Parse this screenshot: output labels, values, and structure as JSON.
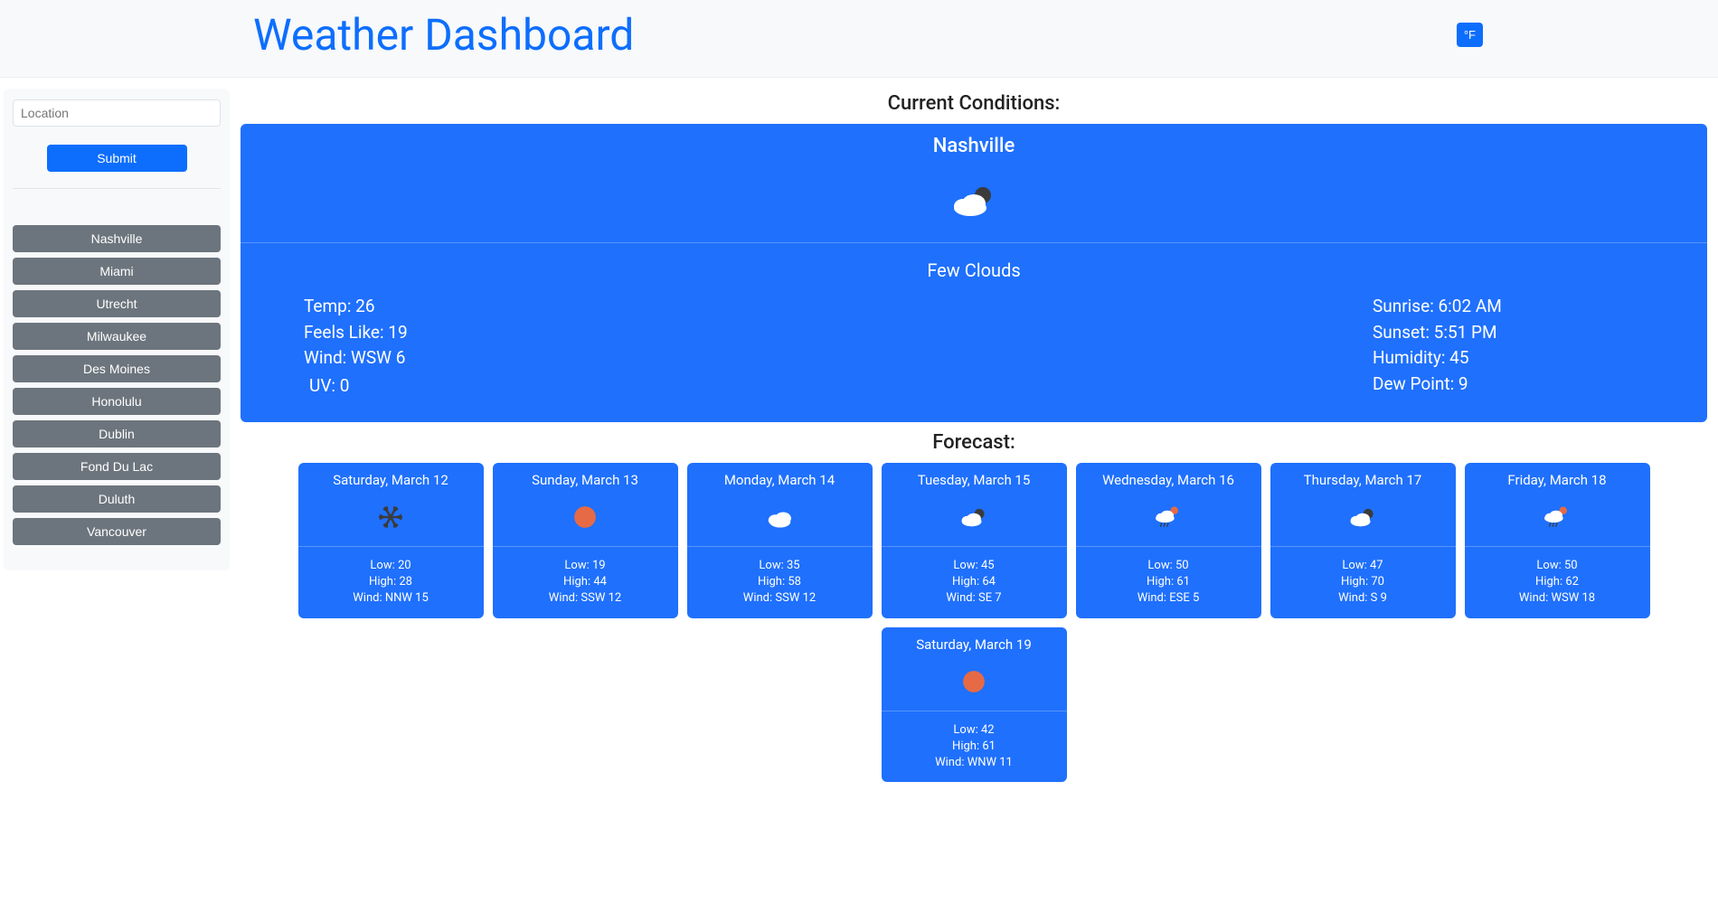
{
  "header": {
    "title": "Weather Dashboard",
    "unit_label": "°F"
  },
  "sidebar": {
    "input_placeholder": "Location",
    "submit_label": "Submit",
    "history": [
      "Nashville",
      "Miami",
      "Utrecht",
      "Milwaukee",
      "Des Moines",
      "Honolulu",
      "Dublin",
      "Fond Du Lac",
      "Duluth",
      "Vancouver"
    ]
  },
  "current": {
    "section_title": "Current Conditions:",
    "city": "Nashville",
    "icon": "few-clouds-night",
    "description": "Few Clouds",
    "left": {
      "temp": "Temp: 26",
      "feels": "Feels Like: 19",
      "wind": "Wind: WSW 6"
    },
    "right": {
      "sunrise": "Sunrise: 6:02 AM",
      "sunset": "Sunset: 5:51 PM",
      "humidity": "Humidity: 45",
      "dew": "Dew Point: 9"
    },
    "uv": "UV: 0"
  },
  "forecast": {
    "section_title": "Forecast:",
    "days": [
      {
        "date": "Saturday, March 12",
        "icon": "snow",
        "low": "Low: 20",
        "high": "High: 28",
        "wind": "Wind: NNW 15"
      },
      {
        "date": "Sunday, March 13",
        "icon": "clear",
        "low": "Low: 19",
        "high": "High: 44",
        "wind": "Wind: SSW 12"
      },
      {
        "date": "Monday, March 14",
        "icon": "clouds",
        "low": "Low: 35",
        "high": "High: 58",
        "wind": "Wind: SSW 12"
      },
      {
        "date": "Tuesday, March 15",
        "icon": "few-clouds-night",
        "low": "Low: 45",
        "high": "High: 64",
        "wind": "Wind: SE 7"
      },
      {
        "date": "Wednesday, March 16",
        "icon": "rain-sun",
        "low": "Low: 50",
        "high": "High: 61",
        "wind": "Wind: ESE 5"
      },
      {
        "date": "Thursday, March 17",
        "icon": "few-clouds-night",
        "low": "Low: 47",
        "high": "High: 70",
        "wind": "Wind: S 9"
      },
      {
        "date": "Friday, March 18",
        "icon": "rain-sun",
        "low": "Low: 50",
        "high": "High: 62",
        "wind": "Wind: WSW 18"
      },
      {
        "date": "Saturday, March 19",
        "icon": "clear",
        "low": "Low: 42",
        "high": "High: 61",
        "wind": "Wind: WNW 11"
      }
    ]
  }
}
